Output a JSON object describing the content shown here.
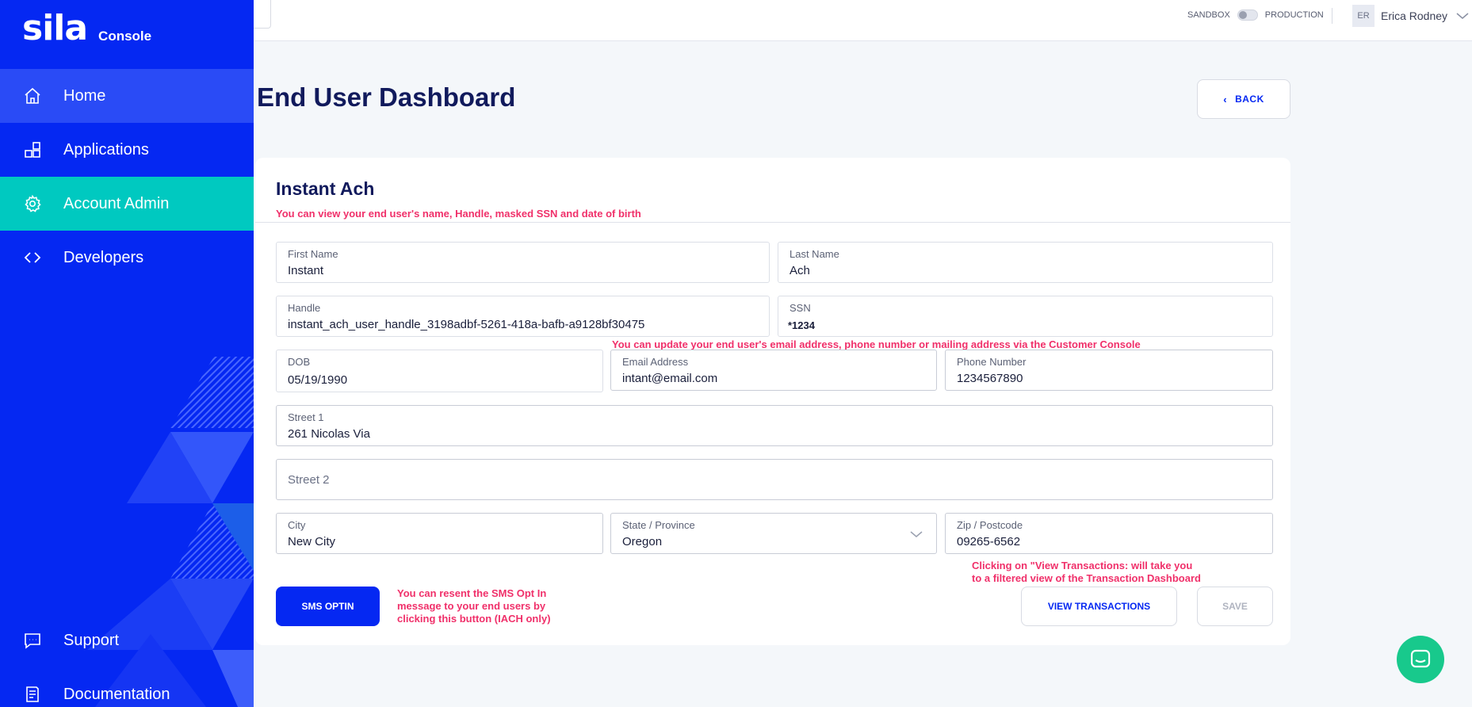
{
  "brand": {
    "logo": "sila",
    "sub": "Console"
  },
  "sidebar": {
    "items": [
      {
        "label": "Home",
        "icon": "home-icon"
      },
      {
        "label": "Applications",
        "icon": "applications-icon"
      },
      {
        "label": "Account Admin",
        "icon": "gear-icon"
      },
      {
        "label": "Developers",
        "icon": "code-icon"
      }
    ],
    "bottom": [
      {
        "label": "Support",
        "icon": "chat-bubble-icon"
      },
      {
        "label": "Documentation",
        "icon": "document-icon"
      }
    ]
  },
  "topbar": {
    "env_left": "SANDBOX",
    "env_right": "PRODUCTION",
    "user_initials": "ER",
    "user_name": "Erica Rodney"
  },
  "page": {
    "title": "End User Dashboard",
    "back_label": "BACK"
  },
  "card": {
    "title": "Instant Ach",
    "hint_top": "You can view your end user's name, Handle, masked SSN and date of birth",
    "hint_update": "You can update your end user's email address, phone number or mailing address via the Customer Console",
    "hint_sms": [
      "You can resent the SMS Opt In",
      "message to your end users by",
      "clicking this button (IACH only)"
    ],
    "hint_view": [
      "Clicking on \"View Transactions: will take you",
      "to a filtered view of the Transaction Dashboard"
    ]
  },
  "fields": {
    "first_name": {
      "label": "First Name",
      "value": "Instant"
    },
    "last_name": {
      "label": "Last Name",
      "value": "Ach"
    },
    "handle": {
      "label": "Handle",
      "value": "instant_ach_user_handle_3198adbf-5261-418a-bafb-a9128bf30475"
    },
    "ssn": {
      "label": "SSN",
      "value": "*1234"
    },
    "dob": {
      "label": "DOB",
      "value": "05/19/1990"
    },
    "email": {
      "label": "Email Address",
      "value": "intant@email.com"
    },
    "phone": {
      "label": "Phone Number",
      "value": "1234567890"
    },
    "street1": {
      "label": "Street 1",
      "value": "261 Nicolas Via"
    },
    "street2": {
      "label": "Street 2",
      "value": ""
    },
    "city": {
      "label": "City",
      "value": "New City"
    },
    "state": {
      "label": "State / Province",
      "value": "Oregon"
    },
    "zip": {
      "label": "Zip / Postcode",
      "value": "09265-6562"
    }
  },
  "buttons": {
    "sms_optin": "SMS OPTIN",
    "view_transactions": "VIEW TRANSACTIONS",
    "save": "SAVE"
  },
  "colors": {
    "brand_blue": "#0528f2",
    "active_teal": "#00c9c0",
    "hint_pink": "#f0306a",
    "chat_green": "#18c98c"
  }
}
